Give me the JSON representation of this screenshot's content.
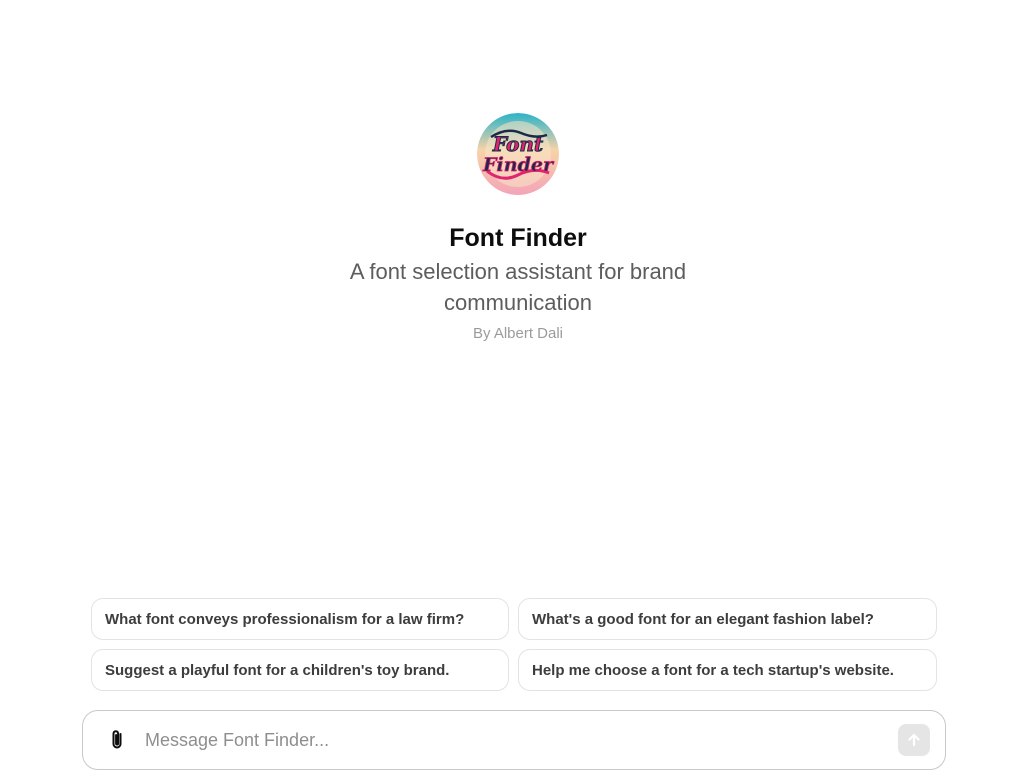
{
  "gpt": {
    "avatar_icon": "font-finder-logo",
    "avatar_text_line1": "Font",
    "avatar_text_line2": "Finder",
    "name": "Font Finder",
    "description": "A font selection assistant for brand communication",
    "author": "By Albert Dali"
  },
  "suggestions": [
    "What font conveys professionalism for a law firm?",
    "What's a good font for an elegant fashion label?",
    "Suggest a playful font for a children's toy brand.",
    "Help me choose a font for a tech startup's website."
  ],
  "composer": {
    "placeholder": "Message Font Finder...",
    "value": "",
    "attach_icon": "paperclip-icon",
    "send_icon": "arrow-up-icon"
  },
  "colors": {
    "title": "#0d0d0d",
    "subtitle": "#5d5d5d",
    "author": "#9b9b9b",
    "suggestion_border": "#e3e3e3",
    "send_disabled": "#e5e5e5"
  }
}
